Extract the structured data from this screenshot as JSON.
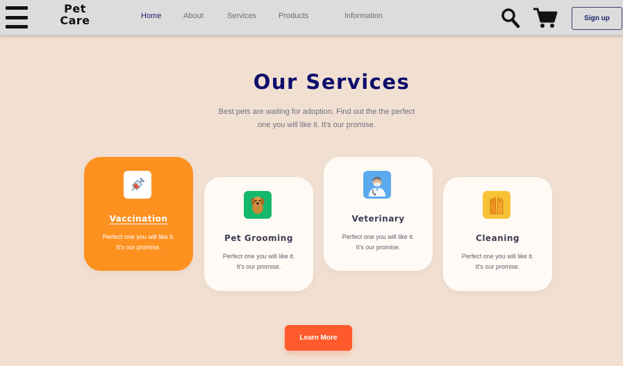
{
  "header": {
    "logo_line1": "Pet",
    "logo_line2": "Care",
    "nav": [
      {
        "label": "Home",
        "active": true
      },
      {
        "label": "About",
        "active": false
      },
      {
        "label": "Services",
        "active": false
      },
      {
        "label": "Products",
        "active": false
      },
      {
        "label": "Information",
        "active": false
      }
    ],
    "signup_label": "Sign up",
    "icons": {
      "menu": "hamburger-menu-icon",
      "search": "search-icon",
      "cart": "cart-icon"
    }
  },
  "section": {
    "title": "Our Services",
    "subtitle_line1": "Best pets are waiting for adoption. Find out the the perfect",
    "subtitle_line2": "one you will like it. It's our promise.",
    "cards": [
      {
        "title": "Vaccination",
        "text_line1": "Perfect one you will like it.",
        "text_line2": "It's our promise.",
        "icon": "syringe-icon",
        "active": true
      },
      {
        "title": "Pet Grooming",
        "text_line1": "Perfect one you will like it.",
        "text_line2": "It's our promise.",
        "icon": "dog-icon",
        "active": false
      },
      {
        "title": "Veterinary",
        "text_line1": "Perfect one you will like it.",
        "text_line2": "It's our promise.",
        "icon": "doctor-icon",
        "active": false
      },
      {
        "title": "Cleaning",
        "text_line1": "Perfect one you will like it.",
        "text_line2": "It's our promise.",
        "icon": "gloves-icon",
        "active": false
      }
    ],
    "learn_more_label": "Learn More"
  },
  "colors": {
    "background": "#f1e0d2",
    "header": "#dcdcdc",
    "title": "#0d0d6b",
    "accent_orange": "#fd9120",
    "button": "#ff5a2c",
    "card": "#fffaf5"
  }
}
